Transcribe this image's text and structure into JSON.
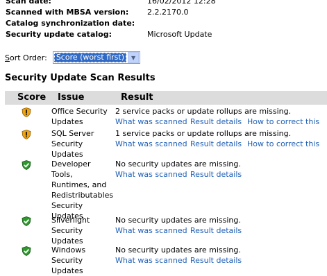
{
  "scan_info": [
    {
      "label": "Scan date:",
      "value": "16/02/2012 12:28"
    },
    {
      "label": "Scanned with MBSA version:",
      "value": "2.2.2170.0"
    },
    {
      "label": "Catalog synchronization date:",
      "value": ""
    },
    {
      "label": "Security update catalog:",
      "value": "Microsoft Update"
    }
  ],
  "sort": {
    "label_prefix": "S",
    "label_rest": "ort Order:",
    "selected": "Score (worst first)"
  },
  "results_heading": "Security Update Scan Results",
  "table": {
    "headers": {
      "score": "Score",
      "issue": "Issue",
      "result": "Result"
    },
    "rows": [
      {
        "icon": "warning-shield-icon",
        "issue": "Office Security Updates",
        "result": "2 service packs or update rollups are missing.",
        "links": [
          "What was scanned",
          "Result details",
          "How to correct this"
        ]
      },
      {
        "icon": "warning-shield-icon",
        "issue": "SQL Server Security Updates",
        "result": "1 service packs or update rollups are missing.",
        "links": [
          "What was scanned",
          "Result details",
          "How to correct this"
        ]
      },
      {
        "icon": "check-shield-icon",
        "issue": "Developer Tools, Runtimes, and Redistributables Security Updates",
        "result": "No security updates are missing.",
        "links": [
          "What was scanned",
          "Result details"
        ]
      },
      {
        "icon": "check-shield-icon",
        "issue": "Silverlight Security Updates",
        "result": "No security updates are missing.",
        "links": [
          "What was scanned",
          "Result details"
        ]
      },
      {
        "icon": "check-shield-icon",
        "issue": "Windows Security Updates",
        "result": "No security updates are missing.",
        "links": [
          "What was scanned",
          "Result details"
        ]
      }
    ]
  },
  "colors": {
    "link": "#1f5fb6",
    "header_bg": "#dcdcdc",
    "warning": "#f2a20d",
    "ok": "#2e9a2e"
  }
}
